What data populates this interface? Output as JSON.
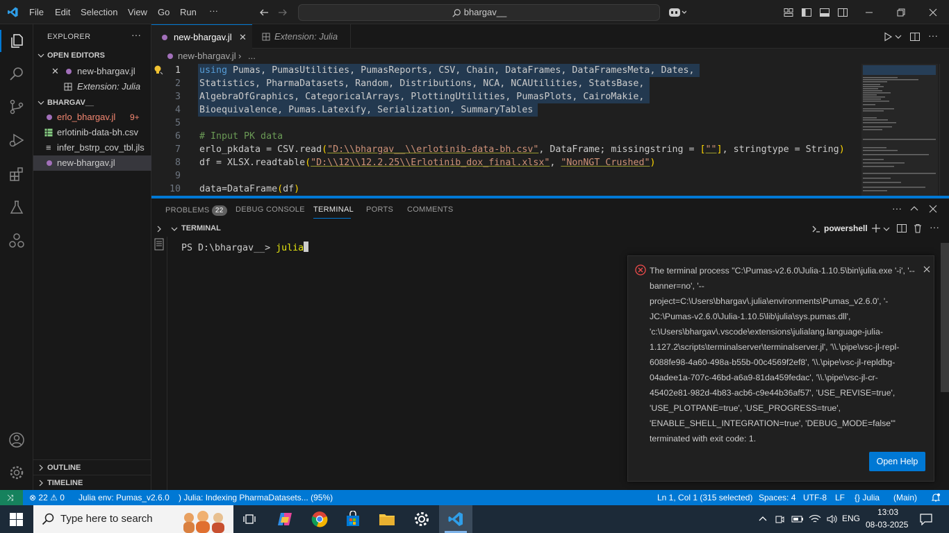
{
  "titlebar": {
    "menu": [
      "File",
      "Edit",
      "Selection",
      "View",
      "Go",
      "Run",
      "···"
    ],
    "search_text": "bhargav__"
  },
  "sidebar": {
    "title": "EXPLORER",
    "open_editors_label": "OPEN EDITORS",
    "open_editors": [
      {
        "label": "new-bhargav.jl",
        "type": "julia"
      },
      {
        "label": "Extension: Julia",
        "type": "extension"
      }
    ],
    "folder_label": "BHARGAV__",
    "files": [
      {
        "label": "erlo_bhargav.jl",
        "badge": "9+",
        "type": "julia-error"
      },
      {
        "label": "erlotinib-data-bh.csv",
        "type": "csv"
      },
      {
        "label": "infer_bstrp_cov_tbl.jls",
        "type": "file"
      },
      {
        "label": "new-bhargav.jl",
        "type": "julia"
      }
    ],
    "outline_label": "OUTLINE",
    "timeline_label": "TIMELINE"
  },
  "editor": {
    "tabs": [
      {
        "label": "new-bhargav.jl",
        "active": true
      },
      {
        "label": "Extension: Julia",
        "active": false
      }
    ],
    "breadcrumb_file": "new-bhargav.jl",
    "breadcrumb_more": "...",
    "lines": [
      {
        "n": "1",
        "text": "using Pumas, PumasUtilities, PumasReports, CSV, Chain, DataFrames, DataFramesMeta, Dates,"
      },
      {
        "n": "2",
        "text": "Statistics, PharmaDatasets, Random, Distributions, NCA, NCAUtilities, StatsBase,"
      },
      {
        "n": "3",
        "text": "AlgebraOfGraphics, CategoricalArrays, PlottingUtilities, PumasPlots, CairoMakie,"
      },
      {
        "n": "4",
        "text": "Bioequivalence, Pumas.Latexify, Serialization, SummaryTables"
      },
      {
        "n": "5",
        "text": ""
      },
      {
        "n": "6",
        "text": "# Input PK data"
      },
      {
        "n": "7",
        "text": "erlo_pkdata = CSV.read(\"D:\\\\bhargav__\\\\erlotinib-data-bh.csv\", DataFrame; missingstring = [\"\"], stringtype = String)"
      },
      {
        "n": "8",
        "text": "df = XLSX.readtable(\"D:\\\\12\\\\12.2.25\\\\Erlotinib_dox_final.xlsx\", \"NonNGT Crushed\")"
      },
      {
        "n": "9",
        "text": ""
      },
      {
        "n": "10",
        "text": "data=DataFrame(df)"
      }
    ]
  },
  "panel": {
    "tabs": [
      {
        "label": "PROBLEMS",
        "badge": "22"
      },
      {
        "label": "DEBUG CONSOLE"
      },
      {
        "label": "TERMINAL",
        "active": true
      },
      {
        "label": "PORTS"
      },
      {
        "label": "COMMENTS"
      }
    ],
    "terminal_header": "TERMINAL",
    "shell": "powershell",
    "prompt": "PS D:\\bhargav__> ",
    "command": "julia"
  },
  "notification": {
    "message": "The terminal process \"C:\\Pumas-v2.6.0\\Julia-1.10.5\\bin\\julia.exe '-i', '--banner=no', '--project=C:\\Users\\bhargav\\.julia\\environments\\Pumas_v2.6.0', '-JC:\\Pumas-v2.6.0\\Julia-1.10.5\\lib\\julia\\sys.pumas.dll', 'c:\\Users\\bhargav\\.vscode\\extensions\\julialang.language-julia-1.127.2\\scripts\\terminalserver\\terminalserver.jl', '\\\\.\\pipe\\vsc-jl-repl-6088fe98-4a60-498a-b55b-00c4569f2ef8', '\\\\.\\pipe\\vsc-jl-repldbg-04adee1a-707c-46bd-a6a9-81da459fedac', '\\\\.\\pipe\\vsc-jl-cr-45402e81-982d-4b83-acb6-c9e44b36af57', 'USE_REVISE=true', 'USE_PLOTPANE=true', 'USE_PROGRESS=true', 'ENABLE_SHELL_INTEGRATION=true', 'DEBUG_MODE=false'\" terminated with exit code: 1.",
    "button": "Open Help"
  },
  "statusbar": {
    "errors": "22",
    "warnings": "0",
    "julia_env": "Julia env: Pumas_v2.6.0",
    "indexing": "Julia: Indexing PharmaDatasets... (95%)",
    "position": "Ln 1, Col 1 (315 selected)",
    "spaces": "Spaces: 4",
    "encoding": "UTF-8",
    "eol": "LF",
    "language": "Julia",
    "main": "(Main)"
  },
  "taskbar": {
    "search_placeholder": "Type here to search",
    "language": "ENG",
    "time": "13:03",
    "date": "08-03-2025"
  },
  "colors": {
    "accent": "#0078d4",
    "keyword": "#569cd6",
    "string": "#ce9178",
    "comment": "#6a9955",
    "error": "#f14c4c"
  }
}
